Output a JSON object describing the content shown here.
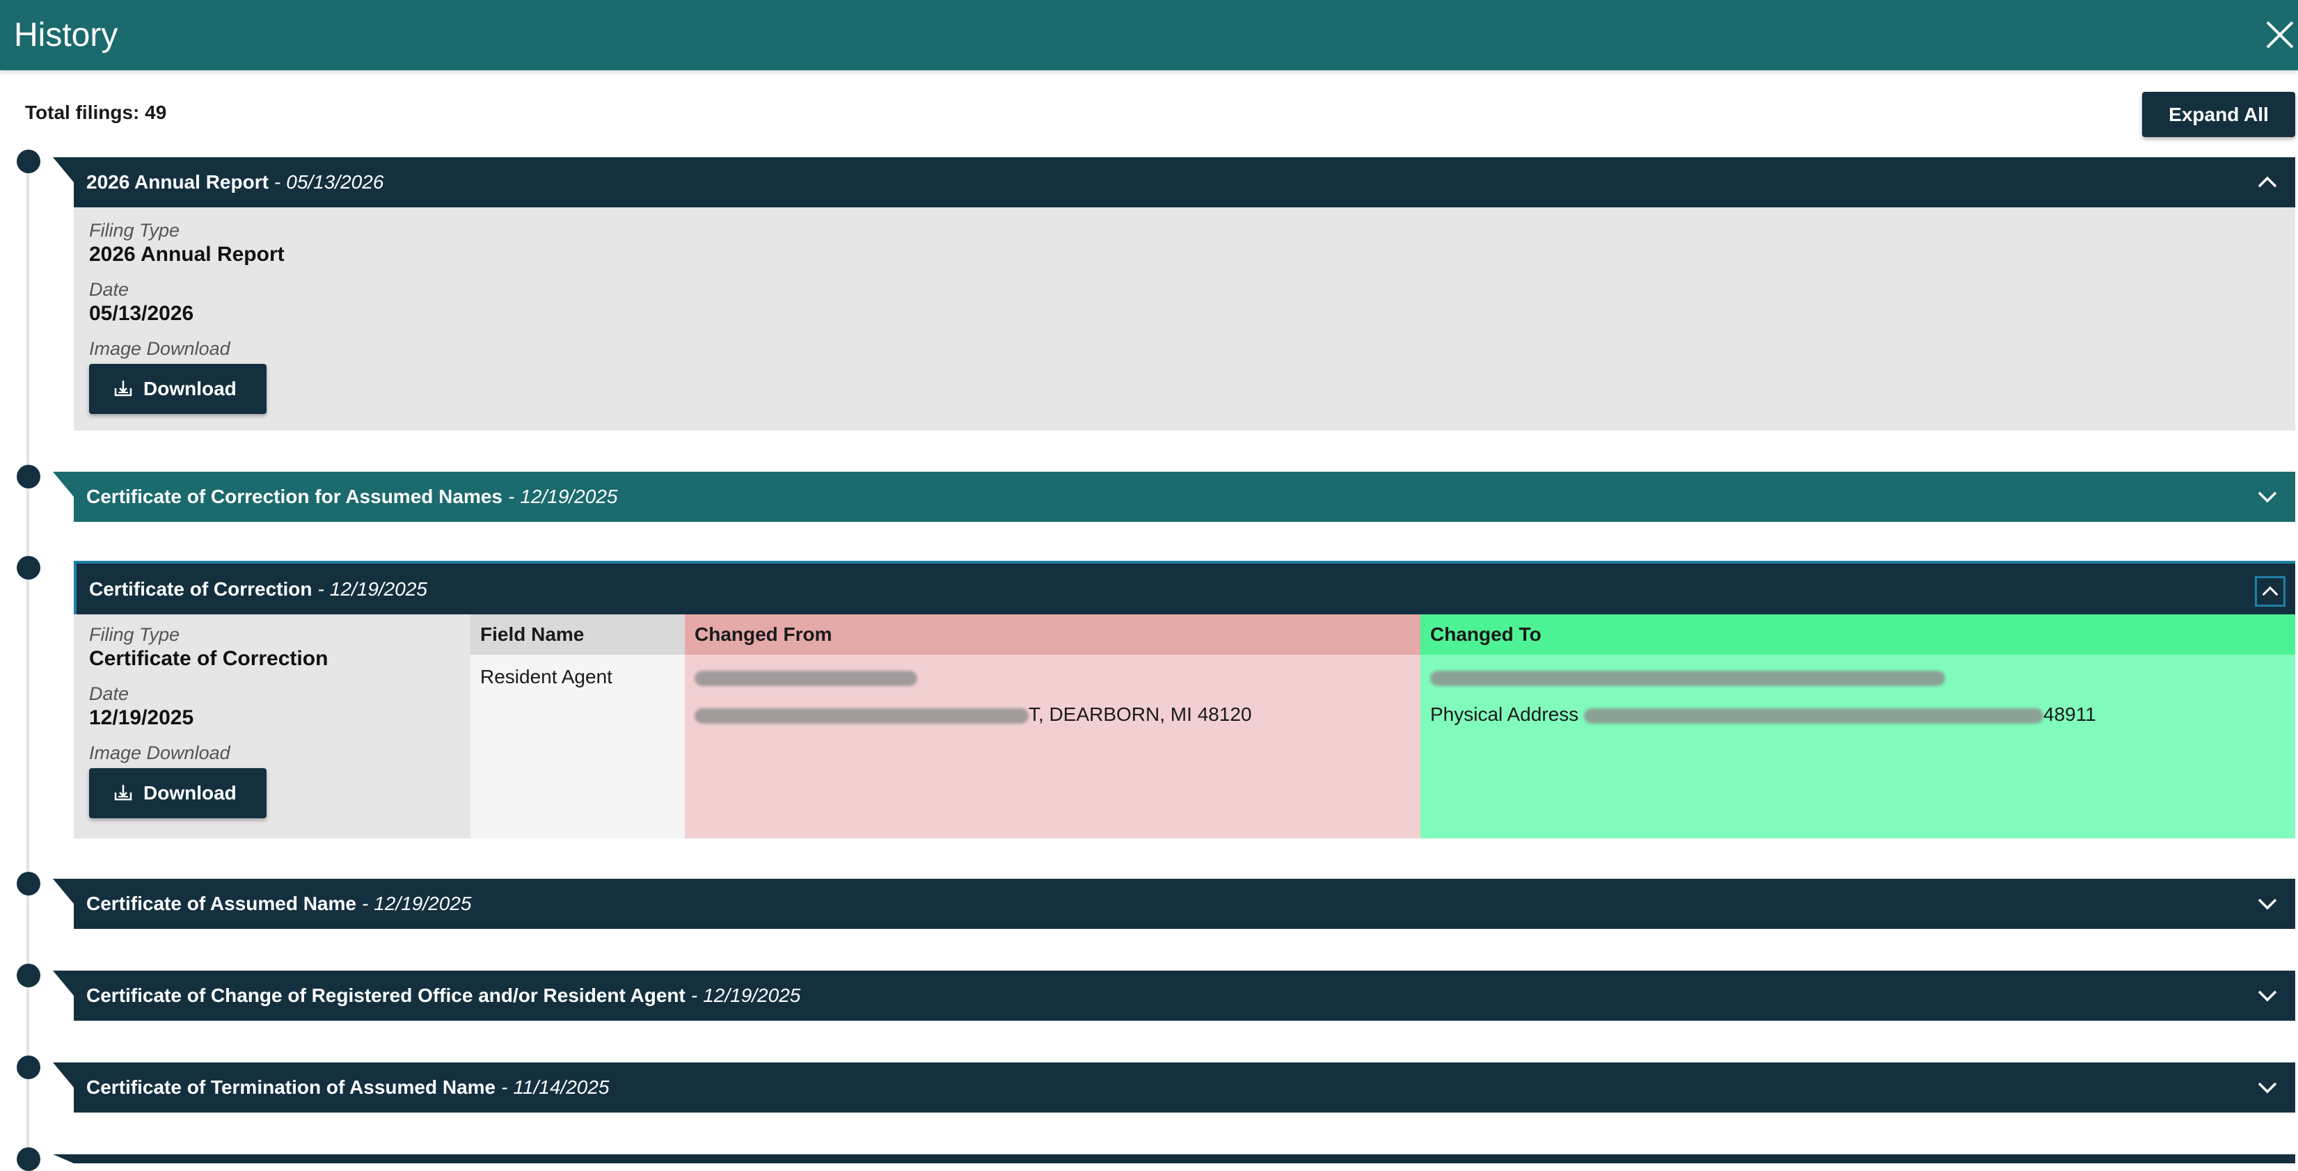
{
  "header": {
    "title": "History"
  },
  "summary": {
    "total_filings": "Total filings: 49",
    "expand_all_label": "Expand All"
  },
  "colors": {
    "header_teal": "#1b6a6d",
    "navy": "#14303f",
    "changed_from_header": "#e5a9a9",
    "changed_from_cell": "#f2d0d2",
    "changed_to_header": "#4df294",
    "changed_to_cell": "#80fbbc"
  },
  "filings": [
    {
      "name": "2026 Annual Report",
      "separator": "-",
      "date": "05/13/2026",
      "expanded": true,
      "details": {
        "filing_type_label": "Filing Type",
        "filing_type": "2026 Annual Report",
        "date_label": "Date",
        "date": "05/13/2026",
        "image_download_label": "Image Download",
        "download_label": "Download"
      }
    },
    {
      "name": "Certificate of Correction for Assumed Names",
      "separator": "-",
      "date": "12/19/2025",
      "expanded": false
    },
    {
      "name": "Certificate of Correction",
      "separator": "-",
      "date": "12/19/2025",
      "expanded": true,
      "details": {
        "filing_type_label": "Filing Type",
        "filing_type": "Certificate of Correction",
        "date_label": "Date",
        "date": "12/19/2025",
        "image_download_label": "Image Download",
        "download_label": "Download"
      },
      "changes": {
        "headers": [
          "Field Name",
          "Changed From",
          "Changed To"
        ],
        "rows": [
          {
            "field": "Resident Agent",
            "from_line2_visible": "T, DEARBORN, MI 48120",
            "to_line2_visible": "Physical Address",
            "to_line2_end": "48911"
          }
        ]
      }
    },
    {
      "name": "Certificate of Assumed Name",
      "separator": "-",
      "date": "12/19/2025",
      "expanded": false
    },
    {
      "name": "Certificate of Change of Registered Office and/or Resident Agent",
      "separator": "-",
      "date": "12/19/2025",
      "expanded": false
    },
    {
      "name": "Certificate of Termination of Assumed Name",
      "separator": "-",
      "date": "11/14/2025",
      "expanded": false
    }
  ],
  "icons": {
    "close": "close-icon",
    "chevron_up": "chevron-up-icon",
    "chevron_down": "chevron-down-icon",
    "download": "download-tray-icon"
  }
}
